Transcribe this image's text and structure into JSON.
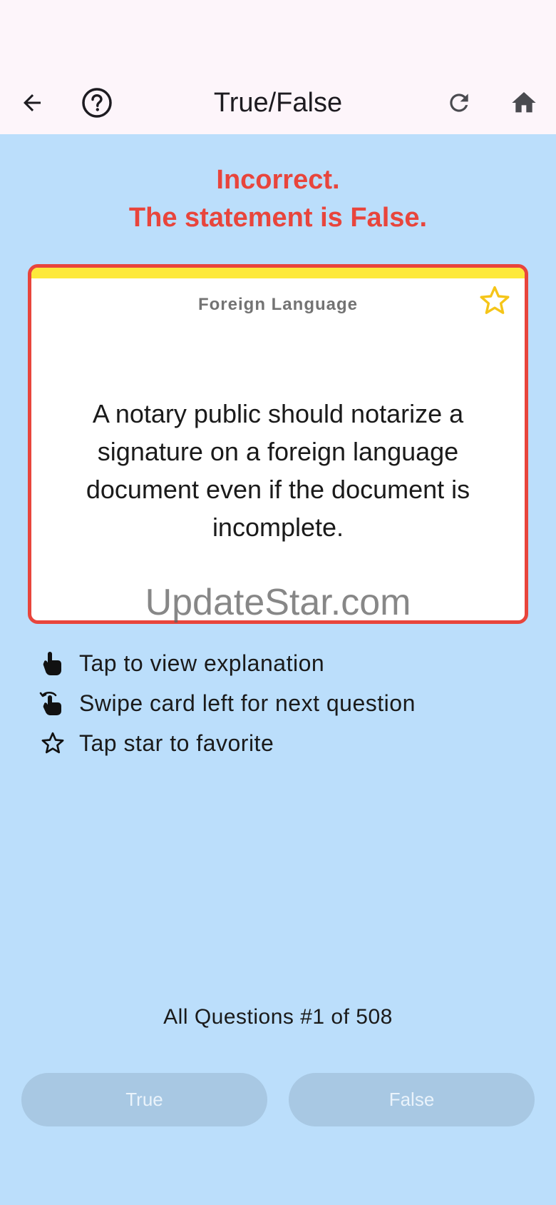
{
  "app_bar": {
    "title": "True/False",
    "icons": [
      "back-arrow-icon",
      "help-circle-icon",
      "refresh-icon",
      "home-icon"
    ]
  },
  "result": {
    "line1": "Incorrect.",
    "line2": "The statement is False.",
    "color": "#e8453c"
  },
  "card": {
    "category": "Foreign Language",
    "question": "A notary public should notarize a signature on a foreign language document even if the document is incomplete.",
    "favorite_icon": "star-outline-icon",
    "border_color": "#e8453c",
    "stripe_color": "#fde93b"
  },
  "watermark": "UpdateStar.com",
  "hints": [
    {
      "icon": "tap-hand-icon",
      "text": "Tap to view explanation"
    },
    {
      "icon": "swipe-hand-icon",
      "text": "Swipe card left for next question"
    },
    {
      "icon": "star-outline-icon",
      "text": "Tap star to favorite"
    }
  ],
  "counter": "All Questions #1 of 508",
  "buttons": {
    "true_label": "True",
    "false_label": "False"
  },
  "colors": {
    "background": "#bbdefb",
    "app_bar": "#fdf5fa",
    "star": "#f5c518",
    "button": "#a8c8e3"
  }
}
